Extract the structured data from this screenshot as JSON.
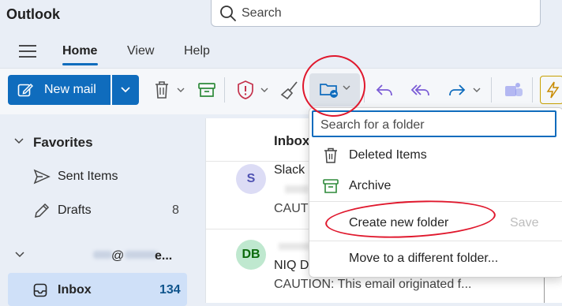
{
  "app": {
    "title": "Outlook"
  },
  "search": {
    "placeholder": "Search"
  },
  "ribbon": {
    "tabs": [
      {
        "label": "Home",
        "active": true
      },
      {
        "label": "View",
        "active": false
      },
      {
        "label": "Help",
        "active": false
      }
    ]
  },
  "toolbar": {
    "new_mail_label": "New mail",
    "buttons": [
      {
        "name": "delete",
        "icon": "trash-icon"
      },
      {
        "name": "archive",
        "icon": "archive-icon"
      },
      {
        "name": "report",
        "icon": "shield-icon"
      },
      {
        "name": "sweep",
        "icon": "broom-icon"
      },
      {
        "name": "move",
        "icon": "folder-move-icon"
      },
      {
        "name": "reply",
        "icon": "reply-icon"
      },
      {
        "name": "reply-all",
        "icon": "reply-all-icon"
      },
      {
        "name": "forward",
        "icon": "forward-icon"
      },
      {
        "name": "teams",
        "icon": "teams-icon"
      },
      {
        "name": "quick-steps",
        "icon": "lightning-icon"
      }
    ]
  },
  "folders": {
    "favorites_label": "Favorites",
    "items": [
      {
        "label": "Sent Items",
        "count": "",
        "icon": "send-icon"
      },
      {
        "label": "Drafts",
        "count": "8",
        "icon": "pencil-icon"
      }
    ],
    "account_label": "@",
    "account_suffix": "e...",
    "inbox": {
      "label": "Inbox",
      "count": "134",
      "icon": "inbox-icon"
    }
  },
  "message_list": {
    "header": "Inbox",
    "messages": [
      {
        "avatar": "S",
        "sender": "Slack",
        "preview": "CAUTION",
        "avatar_color": "#dcdcf5",
        "avatar_text": "#4f52b2"
      },
      {
        "avatar": "DB",
        "sender": "NIQ D",
        "preview": "CAUTION: This email originated f...",
        "avatar_color": "#bfe8cf",
        "avatar_text": "#0b6a0b"
      }
    ]
  },
  "move_menu": {
    "search_placeholder": "Search for a folder",
    "items": [
      {
        "label": "Deleted Items",
        "icon": "trash-icon"
      },
      {
        "label": "Archive",
        "icon": "archive-icon"
      }
    ],
    "create_label": "Create new folder",
    "save_label": "Save",
    "move_label": "Move to a different folder..."
  },
  "colors": {
    "accent": "#0f6cbd",
    "annotation": "#e0182d"
  }
}
